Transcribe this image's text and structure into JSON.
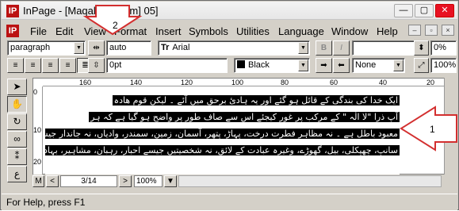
{
  "titlebar": {
    "app_icon": "IP",
    "title": "InPage - [Maqalat e [item] 05]",
    "minimize": "—",
    "maximize": "▢",
    "close": "✕"
  },
  "menubar": {
    "icon": "IP",
    "items": [
      "File",
      "Edit",
      "View",
      "Format",
      "Insert",
      "Symbols",
      "Utilities",
      "Language",
      "Window",
      "Help"
    ],
    "mdi": {
      "minimize": "–",
      "restore": "▫",
      "close": "×"
    }
  },
  "toolbar1": {
    "style_combo": "paragraph",
    "tracking_value": "auto",
    "font_combo": "Arial",
    "font_icon": "Tr",
    "bold": "B",
    "italic": "I",
    "percent_value": "0%"
  },
  "toolbar2": {
    "spacing_value": "0pt",
    "color_combo": "Black",
    "border_combo": "None",
    "zoom_value": "100%"
  },
  "ruler": {
    "ticks": [
      "160",
      "140",
      "120",
      "100",
      "80",
      "60",
      "40",
      "20"
    ]
  },
  "vruler": {
    "ticks": [
      "0",
      "10",
      "20"
    ]
  },
  "document": {
    "lines": [
      "ایک خدا کی بندگی کے قائل ہو گئے اور یہ ہادیٔ برحق میں آئے ۔ لیکن قوم ھادہ",
      "آپ ذرا \"لا الٰہ \" کے مرکب پر غور کیجئے اس سے صاف طور پر واضح ہو گیا ہے کہ ہر",
      "معبود باطل ہے ۔ نہ مظاہر فطرت درخت، پہاڑ، پتھر، آسمان، زمین، سمندر، وادیاں، نہ جاندار جیسے",
      "سانپ، چھپکلی، بیل، گھوڑے، وغیرہ عبادت کے لائق، نہ شخصیتیں جیسے احبار، رہبان، مشاہیر، بہادر"
    ]
  },
  "nav": {
    "page_field": "3/14",
    "zoom": "100%",
    "m_label": "M",
    "prev": "<",
    "next": ">"
  },
  "annotations": {
    "marker1": "1",
    "marker2": "2"
  },
  "statusbar": {
    "text": "For Help, press F1"
  },
  "colors": {
    "window_bg": "#d4d0c8",
    "highlight": "#000000",
    "annotation_red": "#d32f2f"
  }
}
